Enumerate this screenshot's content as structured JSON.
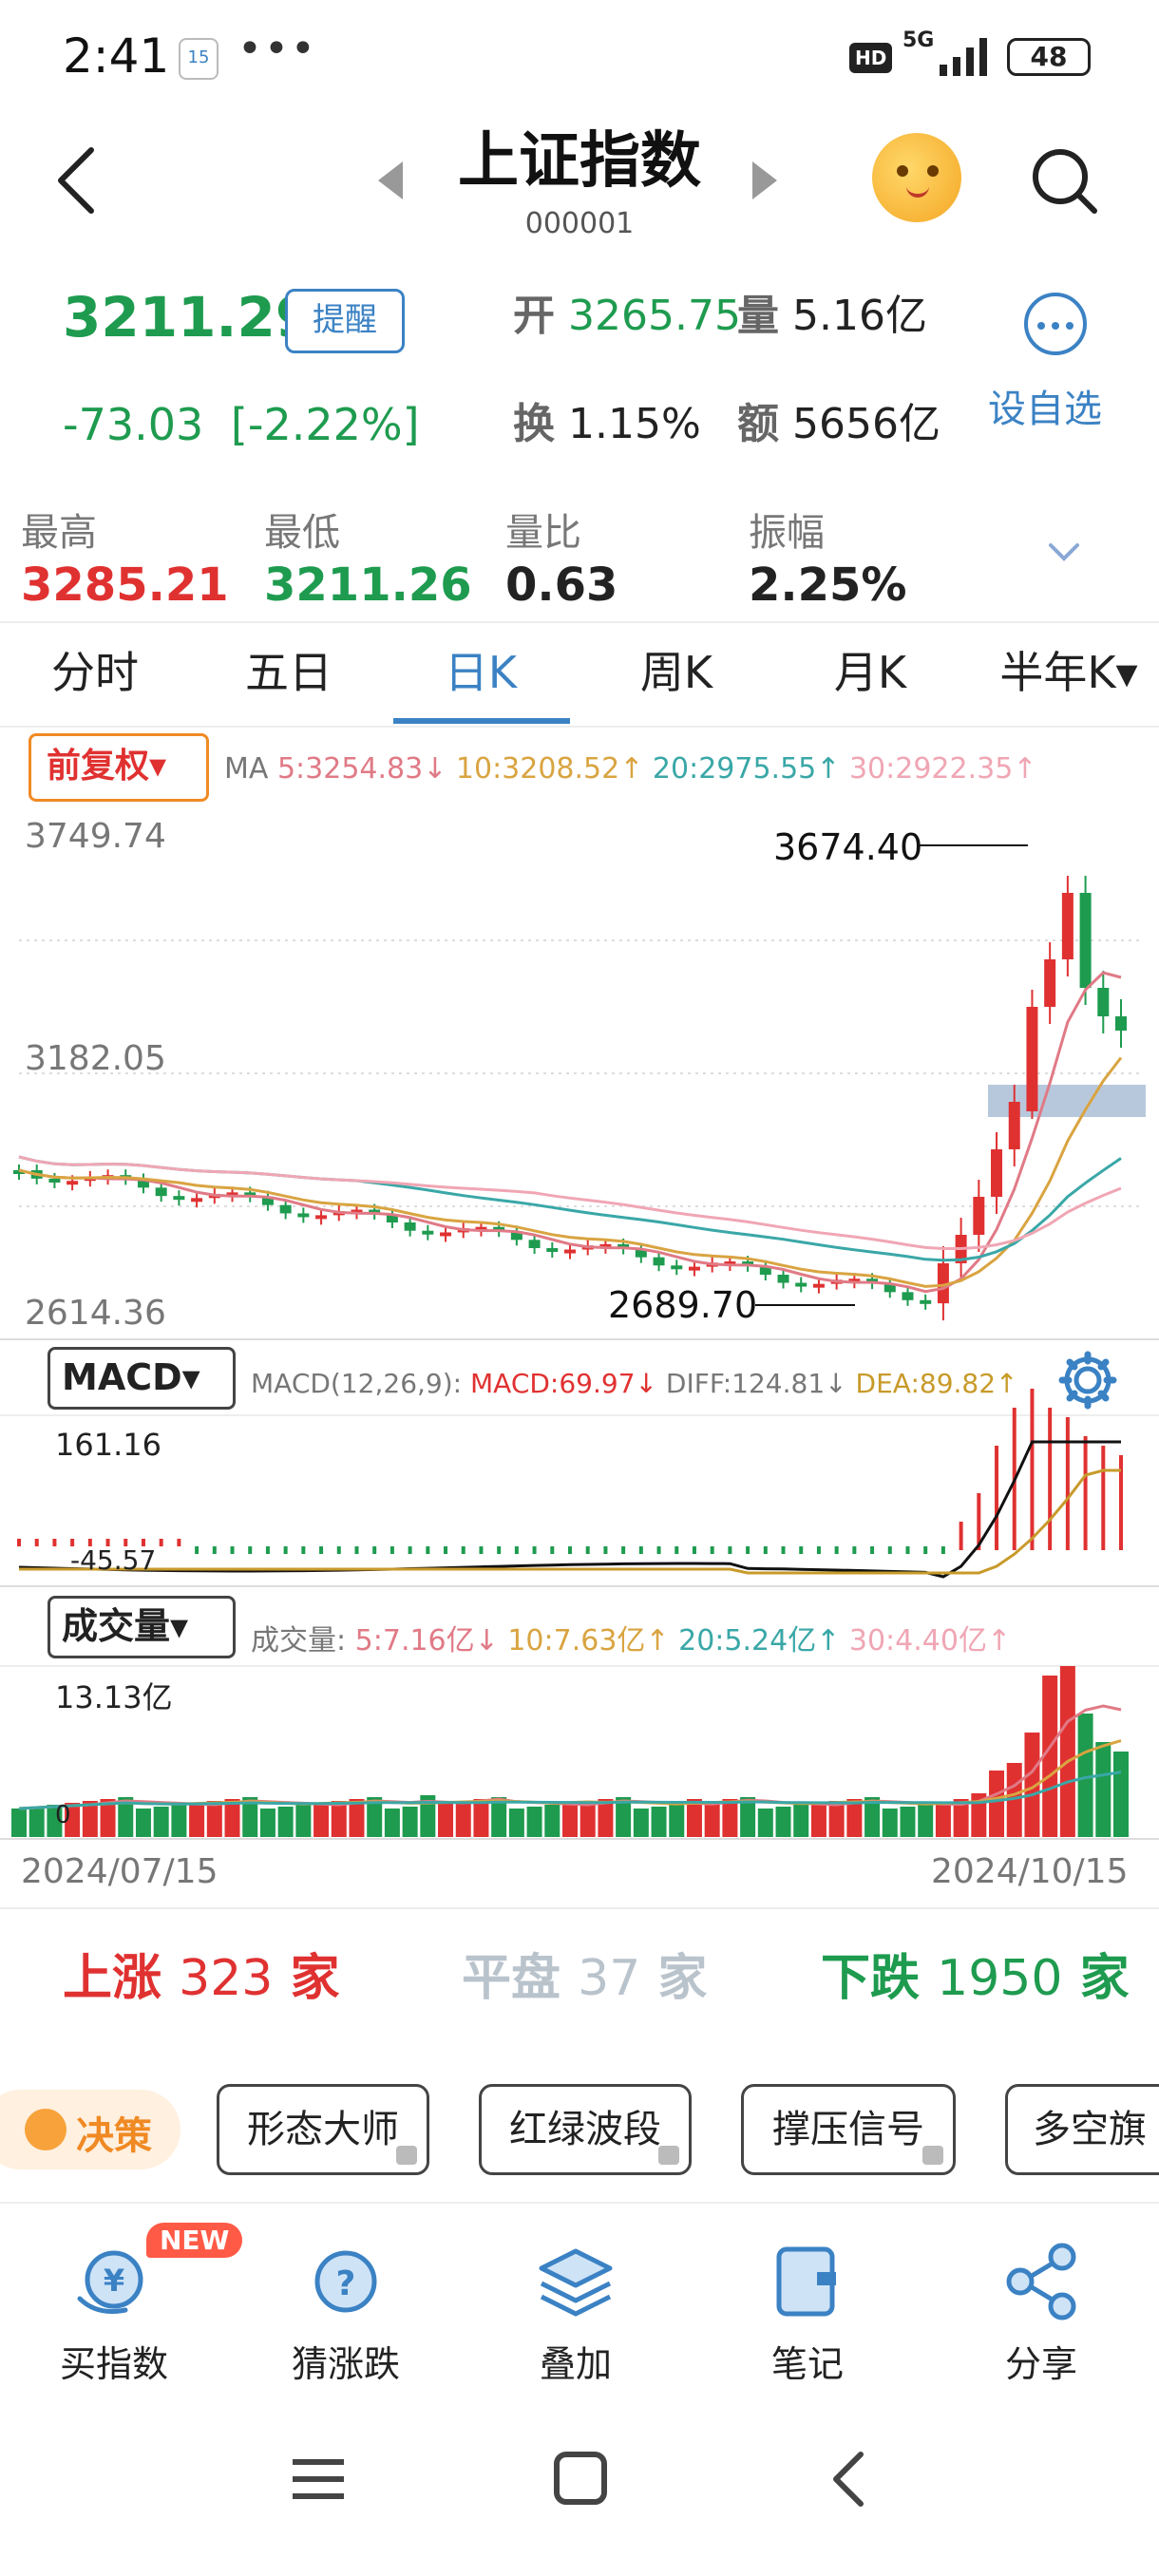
{
  "status_bar": {
    "time": "2:41",
    "calendar_day": "15",
    "more": "•••",
    "hd": "HD",
    "network": "5G",
    "battery": "48"
  },
  "header": {
    "title": "上证指数",
    "code": "000001"
  },
  "quote": {
    "price": "3211.29",
    "alert_label": "提醒",
    "change": "-73.03",
    "change_pct": "[-2.22%]",
    "open_label": "开",
    "open_value": "3265.75",
    "volume_label": "量",
    "volume_value": "5.16亿",
    "turnover_label": "换",
    "turnover_value": "1.15%",
    "amount_label": "额",
    "amount_value": "5656亿",
    "add_fav_label": "设自选"
  },
  "stats": [
    {
      "label": "最高",
      "value": "3285.21",
      "color": "red"
    },
    {
      "label": "最低",
      "value": "3211.26",
      "color": "green"
    },
    {
      "label": "量比",
      "value": "0.63",
      "color": "black"
    },
    {
      "label": "振幅",
      "value": "2.25%",
      "color": "black"
    }
  ],
  "tabs": [
    {
      "label": "分时"
    },
    {
      "label": "五日"
    },
    {
      "label": "日K"
    },
    {
      "label": "周K"
    },
    {
      "label": "月K"
    },
    {
      "label": "半年K▾"
    }
  ],
  "active_tab_index": 2,
  "kline": {
    "adjust_label": "前复权▾",
    "ma_label": "MA",
    "ma5": "5:3254.83↓",
    "ma10": "10:3208.52↑",
    "ma20": "20:2975.55↑",
    "ma30": "30:2922.35↑",
    "y_high": "3749.74",
    "y_mid": "3182.05",
    "y_low": "2614.36",
    "peak_label": "3674.40",
    "trough_label": "2689.70"
  },
  "macd": {
    "selector": "MACD▾",
    "params": "MACD(12,26,9):",
    "macd": "MACD:69.97↓",
    "diff": "DIFF:124.81↓",
    "dea": "DEA:89.82↑",
    "y_high": "161.16",
    "y_low": "-45.57"
  },
  "volume": {
    "selector": "成交量▾",
    "label": "成交量:",
    "v5": "5:7.16亿↓",
    "v10": "10:7.63亿↑",
    "v20": "20:5.24亿↑",
    "v30": "30:4.40亿↑",
    "y_high": "13.13亿",
    "y_zero": "0",
    "date_start": "2024/07/15",
    "date_end": "2024/10/15"
  },
  "breadth": {
    "up_label": "上涨",
    "up_count": "323",
    "up_unit": "家",
    "flat_label": "平盘",
    "flat_count": "37",
    "flat_unit": "家",
    "down_label": "下跌",
    "down_count": "1950",
    "down_unit": "家"
  },
  "tools": {
    "decide": "决策",
    "items": [
      "形态大师",
      "红绿波段",
      "撑压信号",
      "多空旗"
    ]
  },
  "bottom_nav": {
    "new_badge": "NEW",
    "items": [
      "买指数",
      "猜涨跌",
      "叠加",
      "笔记",
      "分享"
    ]
  },
  "colors": {
    "up": "#e03131",
    "down": "#1e9b4f",
    "accent": "#3b82c4",
    "ma5": "#e07a86",
    "ma10": "#d9a441",
    "ma20": "#3aa7a7",
    "ma30": "#f0a6b4"
  }
}
